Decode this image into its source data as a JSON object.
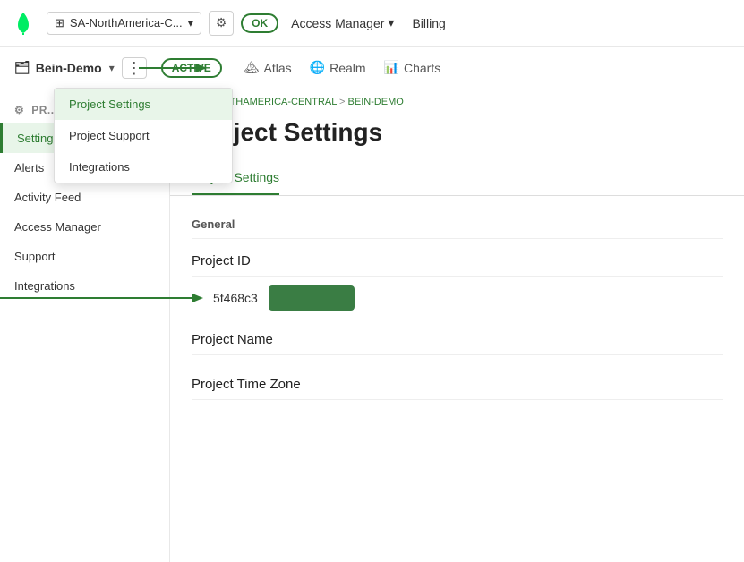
{
  "topNav": {
    "logo_alt": "MongoDB leaf logo",
    "cluster_name": "SA-NorthAmerica-C...",
    "ok_label": "OK",
    "access_manager_label": "Access Manager",
    "billing_label": "Billing"
  },
  "projectBar": {
    "project_name": "Bein-Demo",
    "active_label": "ACTIVE",
    "atlas_label": "Atlas",
    "realm_label": "Realm",
    "charts_label": "Charts"
  },
  "dropdownMenu": {
    "items": [
      {
        "label": "Project Settings",
        "active": true
      },
      {
        "label": "Project Support",
        "active": false
      },
      {
        "label": "Integrations",
        "active": false
      }
    ]
  },
  "sidebar": {
    "section_label": "PR...",
    "items": [
      {
        "label": "Settings",
        "active": true
      },
      {
        "label": "Alerts",
        "active": false
      },
      {
        "label": "Activity Feed",
        "active": false
      },
      {
        "label": "Access Manager",
        "active": false
      },
      {
        "label": "Support",
        "active": false
      },
      {
        "label": "Integrations",
        "active": false
      }
    ]
  },
  "breadcrumb": {
    "parts": [
      {
        "label": "SA-NORTHAMERICA-CENTRAL",
        "link": true
      },
      {
        "label": " > "
      },
      {
        "label": "BEIN-DEMO",
        "link": true
      }
    ]
  },
  "content": {
    "title": "Project Settings",
    "tabs": [
      {
        "label": "Project Settings",
        "active": true
      }
    ],
    "sections": [
      {
        "label": "General",
        "fields": [
          {
            "label": "Project ID",
            "value": "5f468c3"
          },
          {
            "label": "Project Name"
          },
          {
            "label": "Project Time Zone"
          }
        ]
      }
    ]
  }
}
